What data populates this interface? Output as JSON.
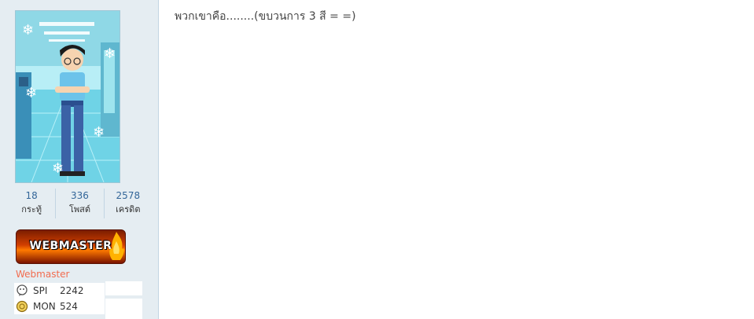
{
  "post": {
    "message": "พวกเขาคือ........(ขบวนการ 3 สี = =)"
  },
  "author": {
    "stats": [
      {
        "value": "18",
        "label": "กระทู้"
      },
      {
        "value": "336",
        "label": "โพสต์"
      },
      {
        "value": "2578",
        "label": "เครดิต"
      }
    ],
    "badge_text": "WEBMASTER",
    "usergroup": "Webmaster",
    "points": [
      {
        "key": "SPI",
        "value": "2242",
        "icon": "spi-icon"
      },
      {
        "key": "MON",
        "value": "524",
        "icon": "coin-icon"
      }
    ]
  },
  "colors": {
    "sidebar_bg": "#e5edf2",
    "usergroup": "#f26c4f",
    "stat_number": "#336699"
  }
}
